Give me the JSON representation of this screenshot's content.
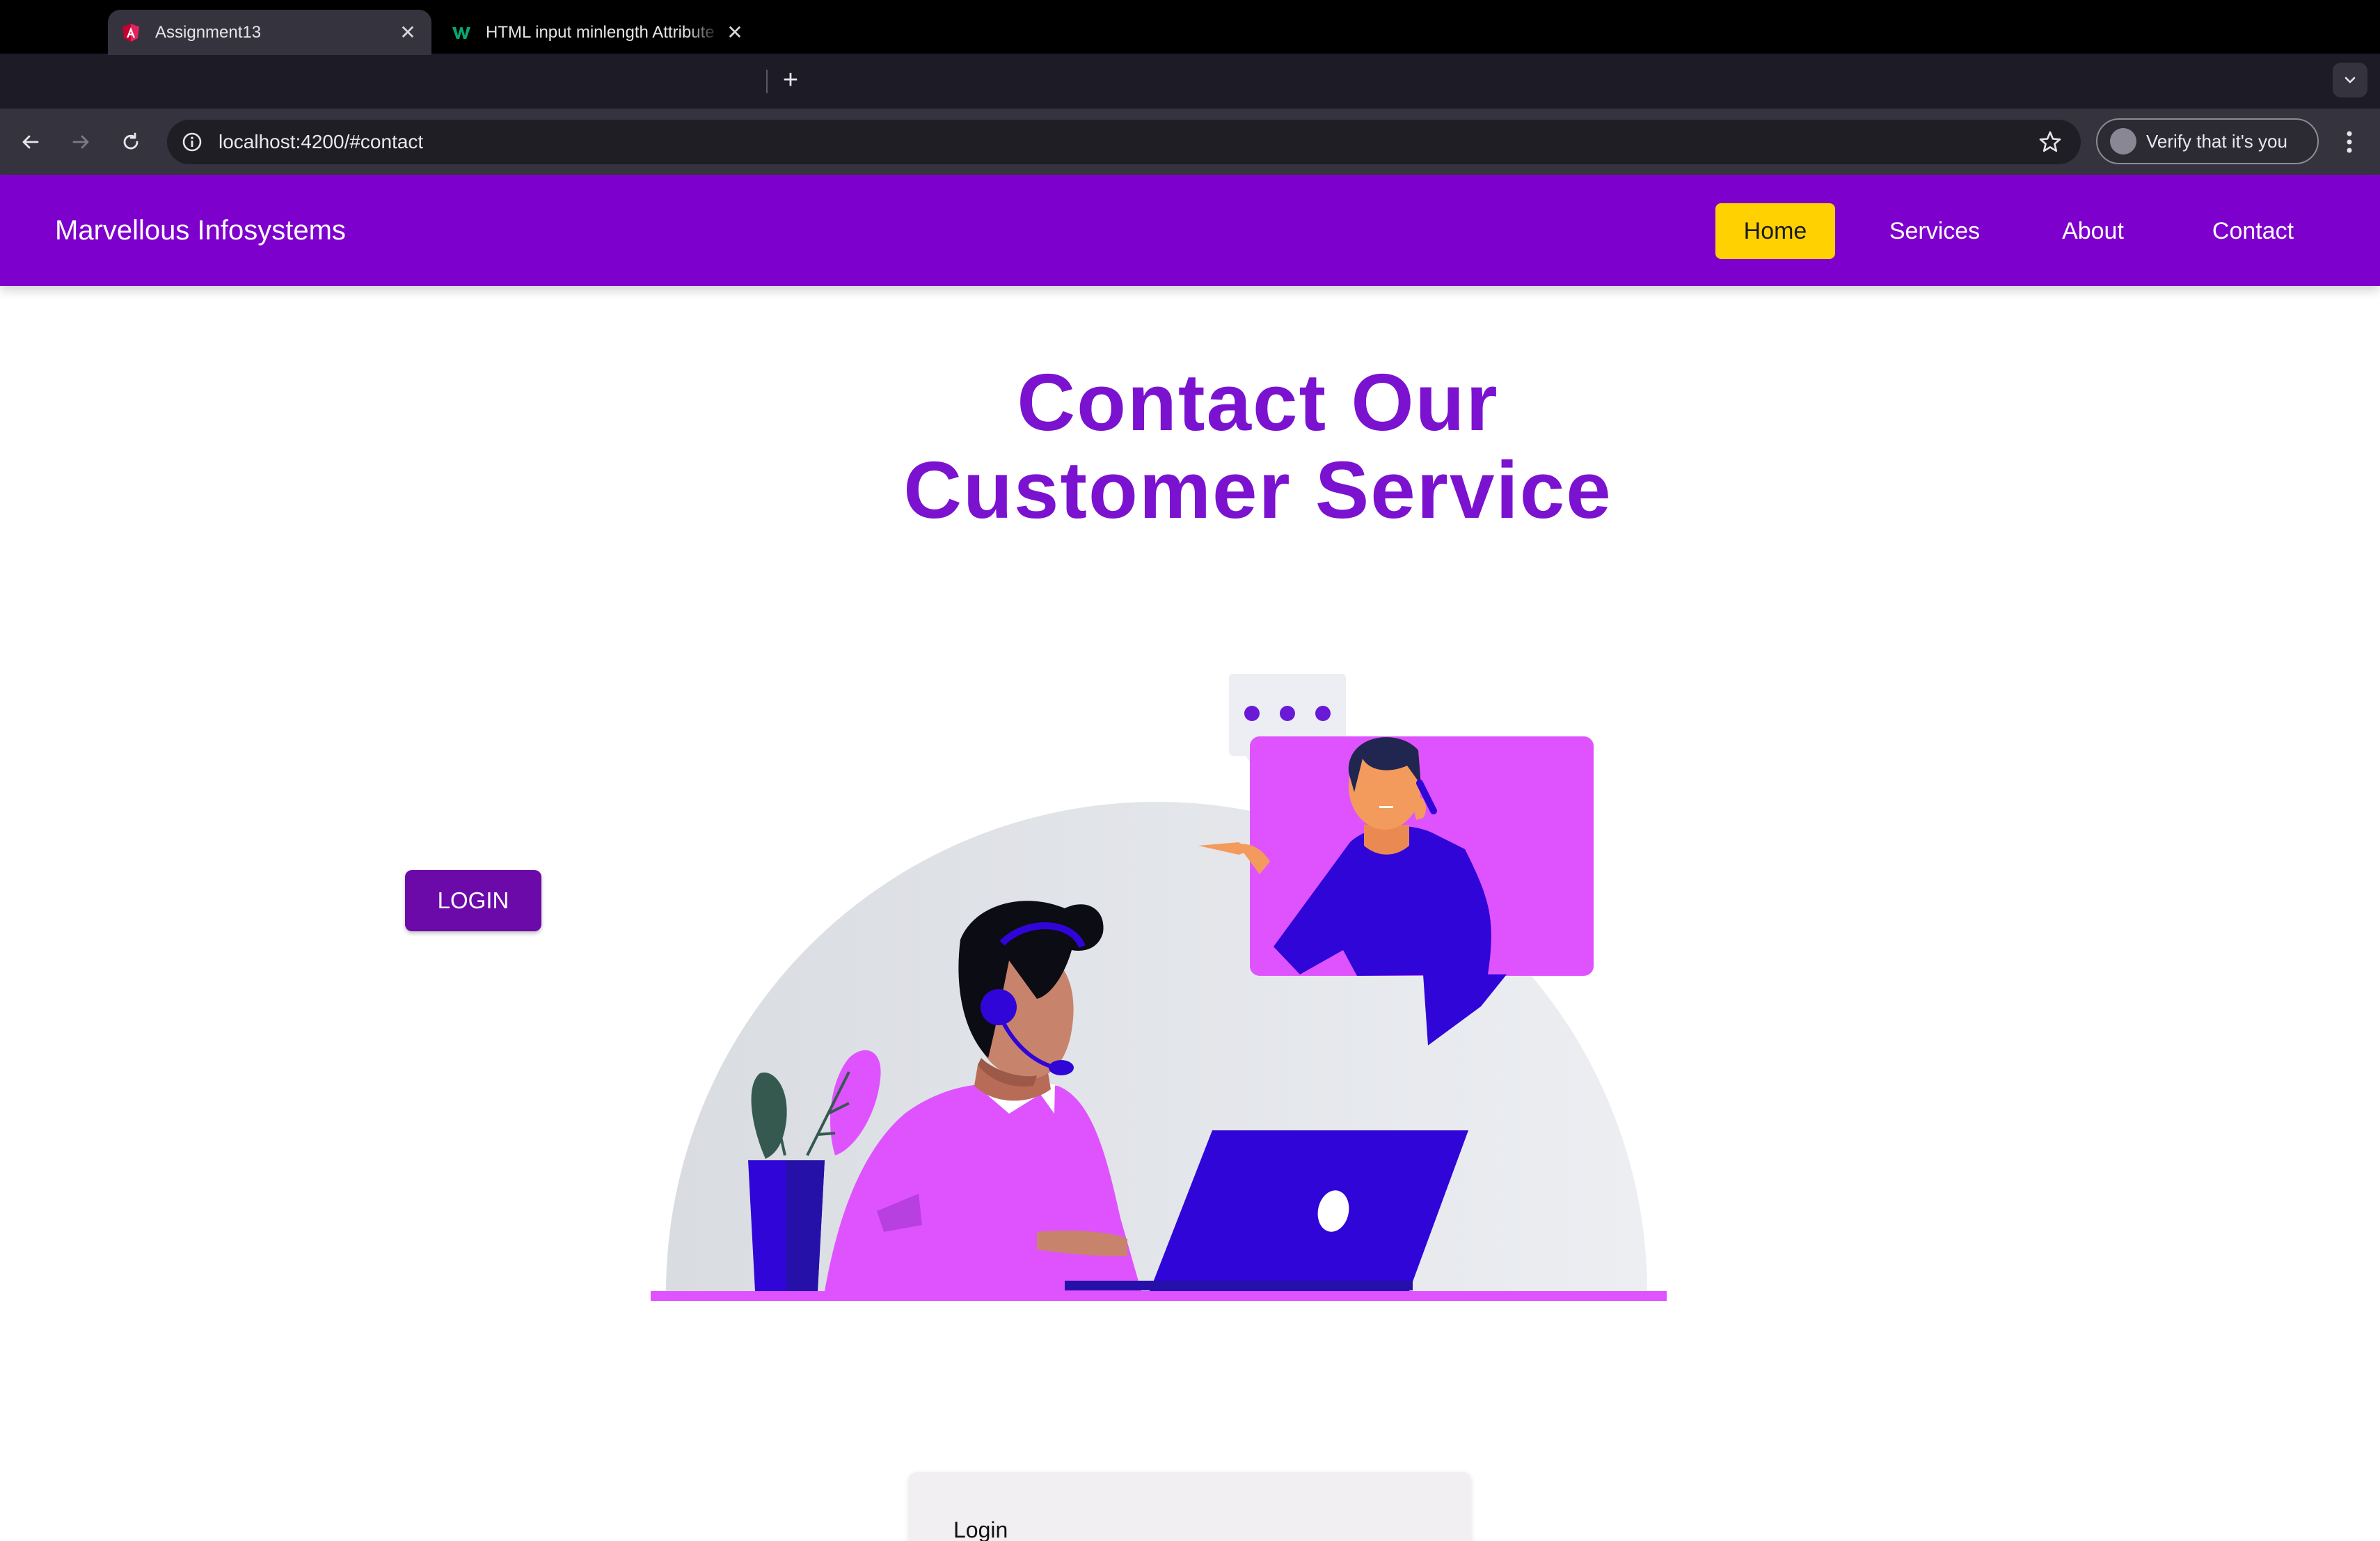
{
  "browser": {
    "tabs": [
      {
        "title": "Assignment13",
        "active": true,
        "favicon": "angular-icon"
      },
      {
        "title": "HTML input minlength Attribute",
        "active": false,
        "favicon": "w3schools-icon"
      }
    ],
    "url": "localhost:4200/#contact",
    "profile_label": "Verify that it's you"
  },
  "nav": {
    "brand": "Marvellous Infosystems",
    "links": [
      {
        "label": "Home",
        "active": true
      },
      {
        "label": "Services",
        "active": false
      },
      {
        "label": "About",
        "active": false
      },
      {
        "label": "Contact",
        "active": false
      }
    ]
  },
  "page": {
    "heading_line1": "Contact Our",
    "heading_line2": "Customer Service",
    "login_button": "LOGIN",
    "login_card_title": "Login"
  },
  "colors": {
    "nav_bg": "#7e00cc",
    "active_link_bg": "#ffd100",
    "heading": "#7b12d0",
    "login_button_bg": "#6b0aa8",
    "illustration_pink": "#df53ff",
    "illustration_blue": "#2f05d8"
  }
}
